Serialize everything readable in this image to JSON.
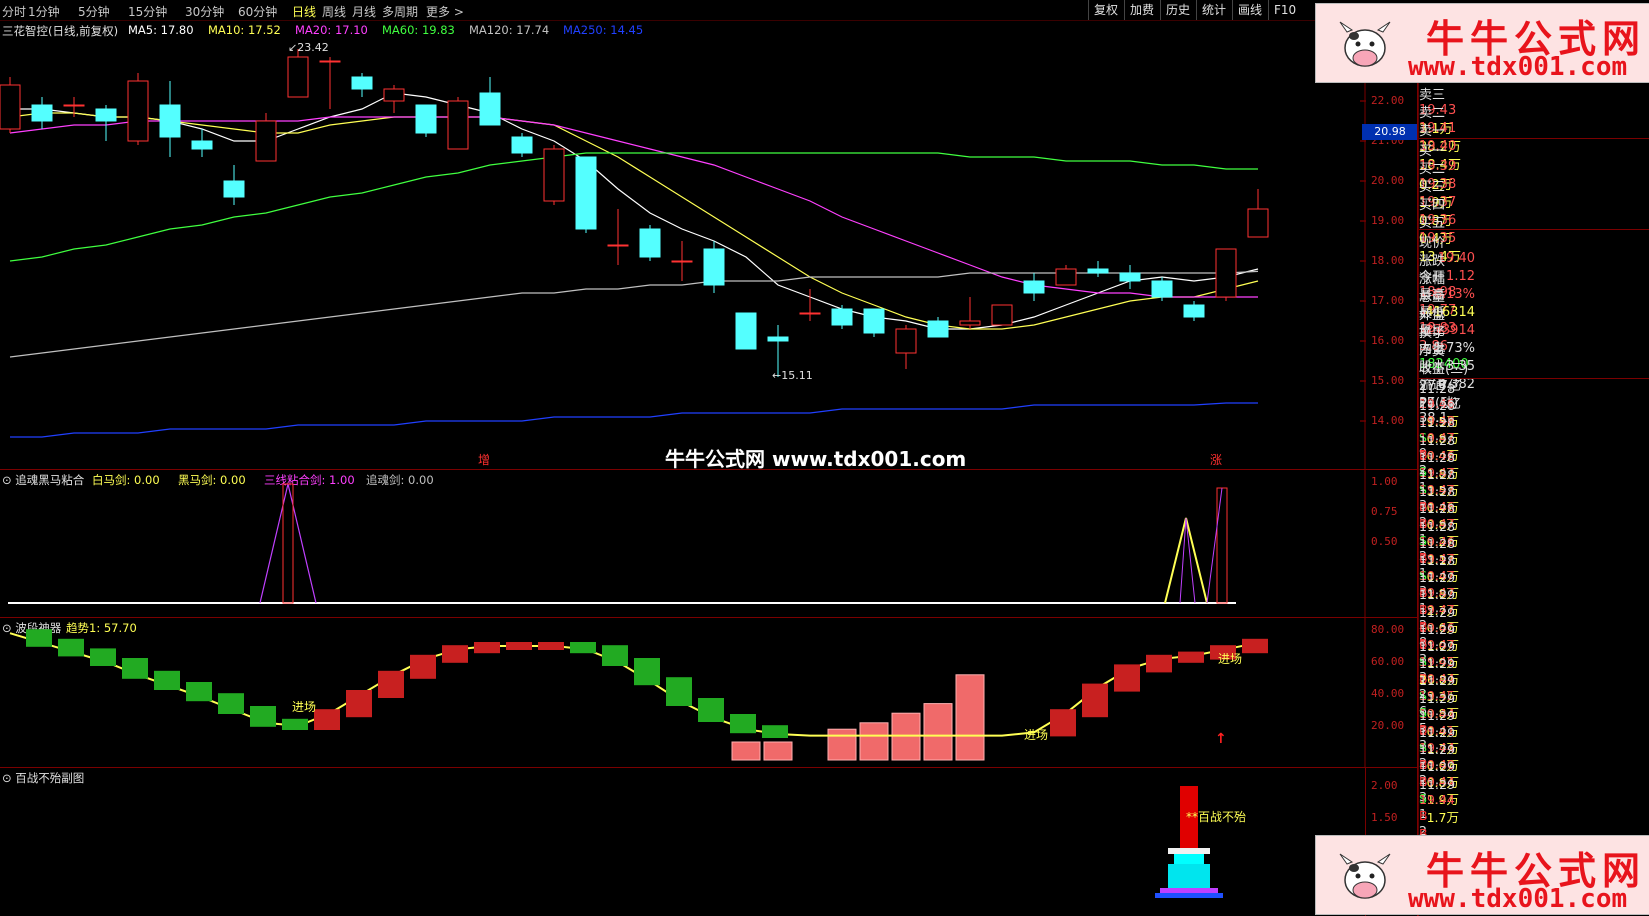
{
  "toolbar": {
    "periods": [
      "分时",
      "1分钟",
      "5分钟",
      "15分钟",
      "30分钟",
      "60分钟",
      "日线",
      "周线",
      "月线",
      "多周期",
      "更多 >"
    ],
    "active_period": "日线",
    "right_buttons": [
      "复权",
      "加费",
      "历史",
      "统计",
      "画线",
      "F10"
    ]
  },
  "main_panel": {
    "stock_name": "三花智控(日线,前复权)",
    "ma_labels": [
      {
        "text": "MA5: 17.80",
        "color": "#ffffff"
      },
      {
        "text": "MA10: 17.52",
        "color": "#ffff54"
      },
      {
        "text": "MA20: 17.10",
        "color": "#ff40ff"
      },
      {
        "text": "MA60: 19.83",
        "color": "#40ff40"
      },
      {
        "text": "MA120: 17.74",
        "color": "#c0c0c0"
      },
      {
        "text": "MA250: 14.45",
        "color": "#2040ff"
      }
    ],
    "high_label": "23.42",
    "low_label": "15.11",
    "price_axis": [
      "22.00",
      "21.00",
      "20.00",
      "19.00",
      "18.00",
      "17.00",
      "16.00",
      "15.00",
      "14.00"
    ],
    "current_price_tag": "20.98",
    "marker_zeng": "增",
    "marker_zhang": "涨",
    "watermark_center": "牛牛公式网 www.tdx001.com"
  },
  "sub1": {
    "title": "追魂黑马粘合",
    "labels": [
      {
        "text": "白马剑: 0.00",
        "color": "#ffff54"
      },
      {
        "text": "黑马剑: 0.00",
        "color": "#ffff54"
      },
      {
        "text": "三线粘合剑: 1.00",
        "color": "#ff40ff"
      },
      {
        "text": "追魂剑: 0.00",
        "color": "#c0c0c0"
      }
    ],
    "axis": [
      "1.00",
      "0.75",
      "0.50"
    ]
  },
  "sub2": {
    "title": "波段神器",
    "label": "趋势1: 57.70",
    "axis": [
      "80.00",
      "60.00",
      "40.00",
      "20.00"
    ],
    "annotations": [
      "进场",
      "进场",
      "进场"
    ]
  },
  "sub3": {
    "title": "百战不殆副图",
    "axis": [
      "2.00",
      "1.50"
    ],
    "annotation": "百战不殆"
  },
  "quote": {
    "sell": [
      {
        "label": "卖三",
        "price": "19.43",
        "vol": "3.1万"
      },
      {
        "label": "卖二",
        "price": "19.41",
        "vol": "38.2万"
      },
      {
        "label": "卖一",
        "price": "19.40",
        "vol": "18.4万"
      }
    ],
    "buy": [
      {
        "label": "买一",
        "price": "19.39",
        "vol": "0.2万"
      },
      {
        "label": "买二",
        "price": "19.38",
        "vol": "1.9万"
      },
      {
        "label": "买三",
        "price": "19.37",
        "vol": "0.8万"
      },
      {
        "label": "买四",
        "price": "19.36",
        "vol": "0.4万"
      },
      {
        "label": "买五",
        "price": "19.35",
        "vol": "13.4万"
      }
    ],
    "stats": [
      {
        "l1": "现价",
        "v1": "19.40",
        "l2": "今开",
        "v2": "18.98",
        "c1": "#ff5050",
        "c2": "#ff5050"
      },
      {
        "l1": "涨跌",
        "v1": "1.12",
        "l2": "最高",
        "v2": "19.77",
        "c1": "#ff5050",
        "c2": "#ff5050"
      },
      {
        "l1": "涨幅",
        "v1": "6.13%",
        "l2": "最低",
        "v2": "18.83",
        "c1": "#ff5050",
        "c2": "#ff5050"
      },
      {
        "l1": "总量",
        "v1": "416314",
        "l2": "量比",
        "v2": "3.86",
        "c1": "#ffff54",
        "c2": "#ff5050"
      },
      {
        "l1": "外盘",
        "v1": "233914",
        "l2": "内盘",
        "v2": "182400",
        "c1": "#ff5050",
        "c2": "#40ff40"
      },
      {
        "l1": "换手",
        "v1": "1.73%",
        "l2": "股本",
        "v2": "27.7亿",
        "c1": "#e0e0e0",
        "c2": "#e0e0e0"
      },
      {
        "l1": "净资",
        "v1": "3.35",
        "l2": "流通",
        "v2": "24.1亿",
        "c1": "#e0e0e0",
        "c2": "#e0e0e0"
      },
      {
        "l1": "收益(三)",
        "v1": "0.382",
        "l2": "PE(动)",
        "v2": "38.1",
        "c1": "#e0e0e0",
        "c2": "#e0e0e0"
      }
    ],
    "ticks": [
      {
        "t": "11:28",
        "p": "19.46",
        "v": "9.5万",
        "s": "S",
        "n": "9"
      },
      {
        "t": "11:28",
        "p": "19.48",
        "v": "0.8万",
        "s": "B",
        "n": "2"
      },
      {
        "t": "11:28",
        "p": "19.47",
        "v": "0.4万",
        "s": "S",
        "n": "1"
      },
      {
        "t": "11:28",
        "p": "19.46",
        "v": "1.8万",
        "s": "S",
        "n": "3"
      },
      {
        "t": "11:28",
        "p": "19.47",
        "v": "3.5万",
        "s": "B",
        "n": "2"
      },
      {
        "t": "11:28",
        "p": "19.47",
        "v": "0.4万",
        "s": "B",
        "n": "1"
      },
      {
        "t": "11:28",
        "p": "19.46",
        "v": "0.8万",
        "s": "S",
        "n": "2"
      },
      {
        "t": "11:28",
        "p": "19.47",
        "v": "0.2万",
        "s": "B",
        "n": "1"
      },
      {
        "t": "11:28",
        "p": "19.46",
        "v": "3.1万",
        "s": "S",
        "n": "3"
      },
      {
        "t": "11:28",
        "p": "19.47",
        "v": "0.4万",
        "s": "B",
        "n": "1"
      },
      {
        "t": "11:28",
        "p": "19.47",
        "v": "1.8万",
        "s": "B",
        "n": "2"
      },
      {
        "t": "11:29",
        "p": "19.47",
        "v": "2.7万",
        "s": "B",
        "n": "8"
      },
      {
        "t": "11:29",
        "p": "19.47",
        "v": "0.6万",
        "s": "B",
        "n": "3"
      },
      {
        "t": "11:29",
        "p": "19.46",
        "v": "1.0万",
        "s": "S",
        "n": "3"
      },
      {
        "t": "11:29",
        "p": "19.47",
        "v": "1.9万",
        "s": "B",
        "n": "2"
      },
      {
        "t": "11:29",
        "p": "19.45",
        "v": "26.8万",
        "s": "S",
        "n": "6"
      },
      {
        "t": "11:29",
        "p": "19.44",
        "v": "3.3万",
        "s": "S",
        "n": "5"
      },
      {
        "t": "11:29",
        "p": "19.45",
        "v": "0.8万",
        "s": "B",
        "n": "3"
      },
      {
        "t": "11:29",
        "p": "19.44",
        "v": "0.4万",
        "s": "S",
        "n": "2"
      },
      {
        "t": "11:29",
        "p": "19.41",
        "v": "1.7万",
        "s": "B",
        "n": "2"
      },
      {
        "t": "11:29",
        "p": "19.44",
        "v": "0.6万",
        "s": "B",
        "n": "3"
      },
      {
        "t": "11:29",
        "p": "19.40",
        "v": "0.8万",
        "s": "S",
        "n": "1"
      },
      {
        "t": "11:29",
        "p": "19.44",
        "v": "1.9万",
        "s": "B",
        "n": "2"
      },
      {
        "t": "11:29",
        "p": "19.44",
        "v": "1.7万",
        "s": "B",
        "n": "3"
      }
    ]
  },
  "watermark": {
    "title": "牛牛公式网",
    "url": "www.tdx001.com"
  },
  "candles": [
    {
      "o": 21.3,
      "c": 22.4,
      "h": 22.6,
      "l": 21.2
    },
    {
      "o": 21.9,
      "c": 21.5,
      "h": 22.1,
      "l": 21.3
    },
    {
      "o": 21.9,
      "c": 21.9,
      "h": 22.1,
      "l": 21.6
    },
    {
      "o": 21.8,
      "c": 21.5,
      "h": 21.9,
      "l": 21.0
    },
    {
      "o": 21.0,
      "c": 22.5,
      "h": 22.7,
      "l": 20.9
    },
    {
      "o": 21.9,
      "c": 21.1,
      "h": 22.5,
      "l": 20.6
    },
    {
      "o": 21.0,
      "c": 20.8,
      "h": 21.3,
      "l": 20.6
    },
    {
      "o": 20.0,
      "c": 19.6,
      "h": 20.4,
      "l": 19.4
    },
    {
      "o": 20.5,
      "c": 21.5,
      "h": 21.7,
      "l": 20.5
    },
    {
      "o": 22.1,
      "c": 23.1,
      "h": 23.3,
      "l": 22.1
    },
    {
      "o": 23.0,
      "c": 23.0,
      "h": 23.1,
      "l": 21.8
    },
    {
      "o": 22.6,
      "c": 22.3,
      "h": 22.7,
      "l": 22.1
    },
    {
      "o": 22.0,
      "c": 22.3,
      "h": 22.4,
      "l": 21.7
    },
    {
      "o": 21.9,
      "c": 21.2,
      "h": 21.9,
      "l": 21.1
    },
    {
      "o": 20.8,
      "c": 22.0,
      "h": 22.1,
      "l": 20.8
    },
    {
      "o": 22.2,
      "c": 21.4,
      "h": 22.6,
      "l": 21.4
    },
    {
      "o": 21.1,
      "c": 20.7,
      "h": 21.2,
      "l": 20.6
    },
    {
      "o": 19.5,
      "c": 20.8,
      "h": 20.9,
      "l": 19.4
    },
    {
      "o": 20.6,
      "c": 18.8,
      "h": 20.6,
      "l": 18.7
    },
    {
      "o": 18.4,
      "c": 18.4,
      "h": 19.3,
      "l": 17.9
    },
    {
      "o": 18.8,
      "c": 18.1,
      "h": 18.9,
      "l": 18.0
    },
    {
      "o": 18.0,
      "c": 18.0,
      "h": 18.5,
      "l": 17.5
    },
    {
      "o": 18.3,
      "c": 17.4,
      "h": 18.5,
      "l": 17.2
    },
    {
      "o": 16.7,
      "c": 15.8,
      "h": 16.7,
      "l": 15.8
    },
    {
      "o": 16.1,
      "c": 16.0,
      "h": 16.4,
      "l": 15.1
    },
    {
      "o": 16.7,
      "c": 16.7,
      "h": 17.3,
      "l": 16.5
    },
    {
      "o": 16.8,
      "c": 16.4,
      "h": 16.9,
      "l": 16.3
    },
    {
      "o": 16.8,
      "c": 16.2,
      "h": 16.8,
      "l": 16.1
    },
    {
      "o": 15.7,
      "c": 16.3,
      "h": 16.4,
      "l": 15.3
    },
    {
      "o": 16.5,
      "c": 16.1,
      "h": 16.6,
      "l": 16.1
    },
    {
      "o": 16.4,
      "c": 16.5,
      "h": 17.1,
      "l": 16.3
    },
    {
      "o": 16.4,
      "c": 16.9,
      "h": 16.9,
      "l": 16.4
    },
    {
      "o": 17.5,
      "c": 17.2,
      "h": 17.7,
      "l": 17.0
    },
    {
      "o": 17.4,
      "c": 17.8,
      "h": 17.9,
      "l": 17.4
    },
    {
      "o": 17.8,
      "c": 17.7,
      "h": 18.0,
      "l": 17.6
    },
    {
      "o": 17.7,
      "c": 17.5,
      "h": 17.9,
      "l": 17.3
    },
    {
      "o": 17.5,
      "c": 17.1,
      "h": 17.6,
      "l": 17.0
    },
    {
      "o": 16.9,
      "c": 16.6,
      "h": 17.0,
      "l": 16.5
    },
    {
      "o": 17.1,
      "c": 18.3,
      "h": 18.3,
      "l": 17.0
    },
    {
      "o": 18.6,
      "c": 19.3,
      "h": 19.8,
      "l": 18.8
    }
  ],
  "ma_lines": {
    "ma5": {
      "color": "#ffffff",
      "v": [
        21.8,
        21.8,
        21.7,
        21.6,
        21.6,
        21.5,
        21.3,
        21.0,
        21.0,
        21.3,
        21.6,
        21.8,
        22.2,
        22.1,
        21.9,
        21.7,
        21.3,
        21.0,
        20.5,
        19.8,
        19.2,
        18.8,
        18.5,
        18.1,
        17.4,
        17.1,
        16.8,
        16.6,
        16.5,
        16.3,
        16.3,
        16.4,
        16.6,
        16.9,
        17.2,
        17.5,
        17.6,
        17.5,
        17.6,
        17.8
      ]
    },
    "ma10": {
      "color": "#ffff54",
      "v": [
        21.6,
        21.7,
        21.7,
        21.6,
        21.6,
        21.5,
        21.4,
        21.3,
        21.2,
        21.2,
        21.4,
        21.5,
        21.6,
        21.6,
        21.6,
        21.6,
        21.5,
        21.4,
        21.0,
        20.6,
        20.1,
        19.6,
        19.1,
        18.6,
        18.1,
        17.6,
        17.2,
        16.9,
        16.6,
        16.4,
        16.3,
        16.3,
        16.4,
        16.6,
        16.8,
        17.0,
        17.1,
        17.1,
        17.3,
        17.5
      ]
    },
    "ma20": {
      "color": "#ff40ff",
      "v": [
        21.2,
        21.3,
        21.4,
        21.4,
        21.5,
        21.5,
        21.5,
        21.5,
        21.5,
        21.5,
        21.6,
        21.6,
        21.6,
        21.6,
        21.6,
        21.6,
        21.5,
        21.4,
        21.2,
        21.0,
        20.8,
        20.6,
        20.4,
        20.1,
        19.8,
        19.5,
        19.1,
        18.8,
        18.5,
        18.2,
        17.9,
        17.6,
        17.4,
        17.3,
        17.2,
        17.2,
        17.1,
        17.1,
        17.1,
        17.1
      ]
    },
    "ma60": {
      "color": "#40ff40",
      "v": [
        18.0,
        18.1,
        18.3,
        18.4,
        18.6,
        18.8,
        18.9,
        19.1,
        19.2,
        19.4,
        19.6,
        19.7,
        19.9,
        20.1,
        20.2,
        20.4,
        20.5,
        20.6,
        20.7,
        20.7,
        20.7,
        20.7,
        20.7,
        20.7,
        20.7,
        20.7,
        20.7,
        20.7,
        20.7,
        20.7,
        20.6,
        20.6,
        20.6,
        20.5,
        20.5,
        20.5,
        20.4,
        20.4,
        20.3,
        20.3
      ]
    },
    "ma120": {
      "color": "#c0c0c0",
      "v": [
        15.6,
        15.7,
        15.8,
        15.9,
        16.0,
        16.1,
        16.2,
        16.3,
        16.4,
        16.5,
        16.6,
        16.7,
        16.8,
        16.9,
        17.0,
        17.1,
        17.2,
        17.2,
        17.3,
        17.3,
        17.4,
        17.4,
        17.5,
        17.5,
        17.5,
        17.6,
        17.6,
        17.6,
        17.6,
        17.6,
        17.7,
        17.7,
        17.7,
        17.7,
        17.7,
        17.7,
        17.7,
        17.7,
        17.7,
        17.74
      ]
    },
    "ma250": {
      "color": "#2040ff",
      "v": [
        13.6,
        13.6,
        13.7,
        13.7,
        13.7,
        13.8,
        13.8,
        13.8,
        13.8,
        13.9,
        13.9,
        13.9,
        13.9,
        14.0,
        14.0,
        14.0,
        14.0,
        14.1,
        14.1,
        14.1,
        14.1,
        14.2,
        14.2,
        14.2,
        14.2,
        14.2,
        14.3,
        14.3,
        14.3,
        14.3,
        14.3,
        14.3,
        14.4,
        14.4,
        14.4,
        14.4,
        14.4,
        14.4,
        14.45,
        14.45
      ]
    }
  },
  "wave": {
    "values": [
      78,
      72,
      66,
      60,
      52,
      45,
      38,
      30,
      22,
      20,
      28,
      40,
      52,
      62,
      68,
      70,
      70,
      70,
      68,
      60,
      48,
      35,
      25,
      18,
      15,
      14,
      14,
      14,
      14,
      14,
      14,
      14,
      16,
      28,
      44,
      56,
      62,
      64,
      68,
      72
    ],
    "bars": [
      0,
      0,
      0,
      0,
      0,
      0,
      0,
      0,
      0,
      0,
      0,
      0,
      0,
      0,
      0,
      0,
      0,
      0,
      0,
      0,
      0,
      0,
      0,
      10,
      10,
      0,
      18,
      22,
      28,
      34,
      52,
      0,
      0,
      0,
      0,
      0,
      0,
      0,
      0,
      0
    ]
  }
}
